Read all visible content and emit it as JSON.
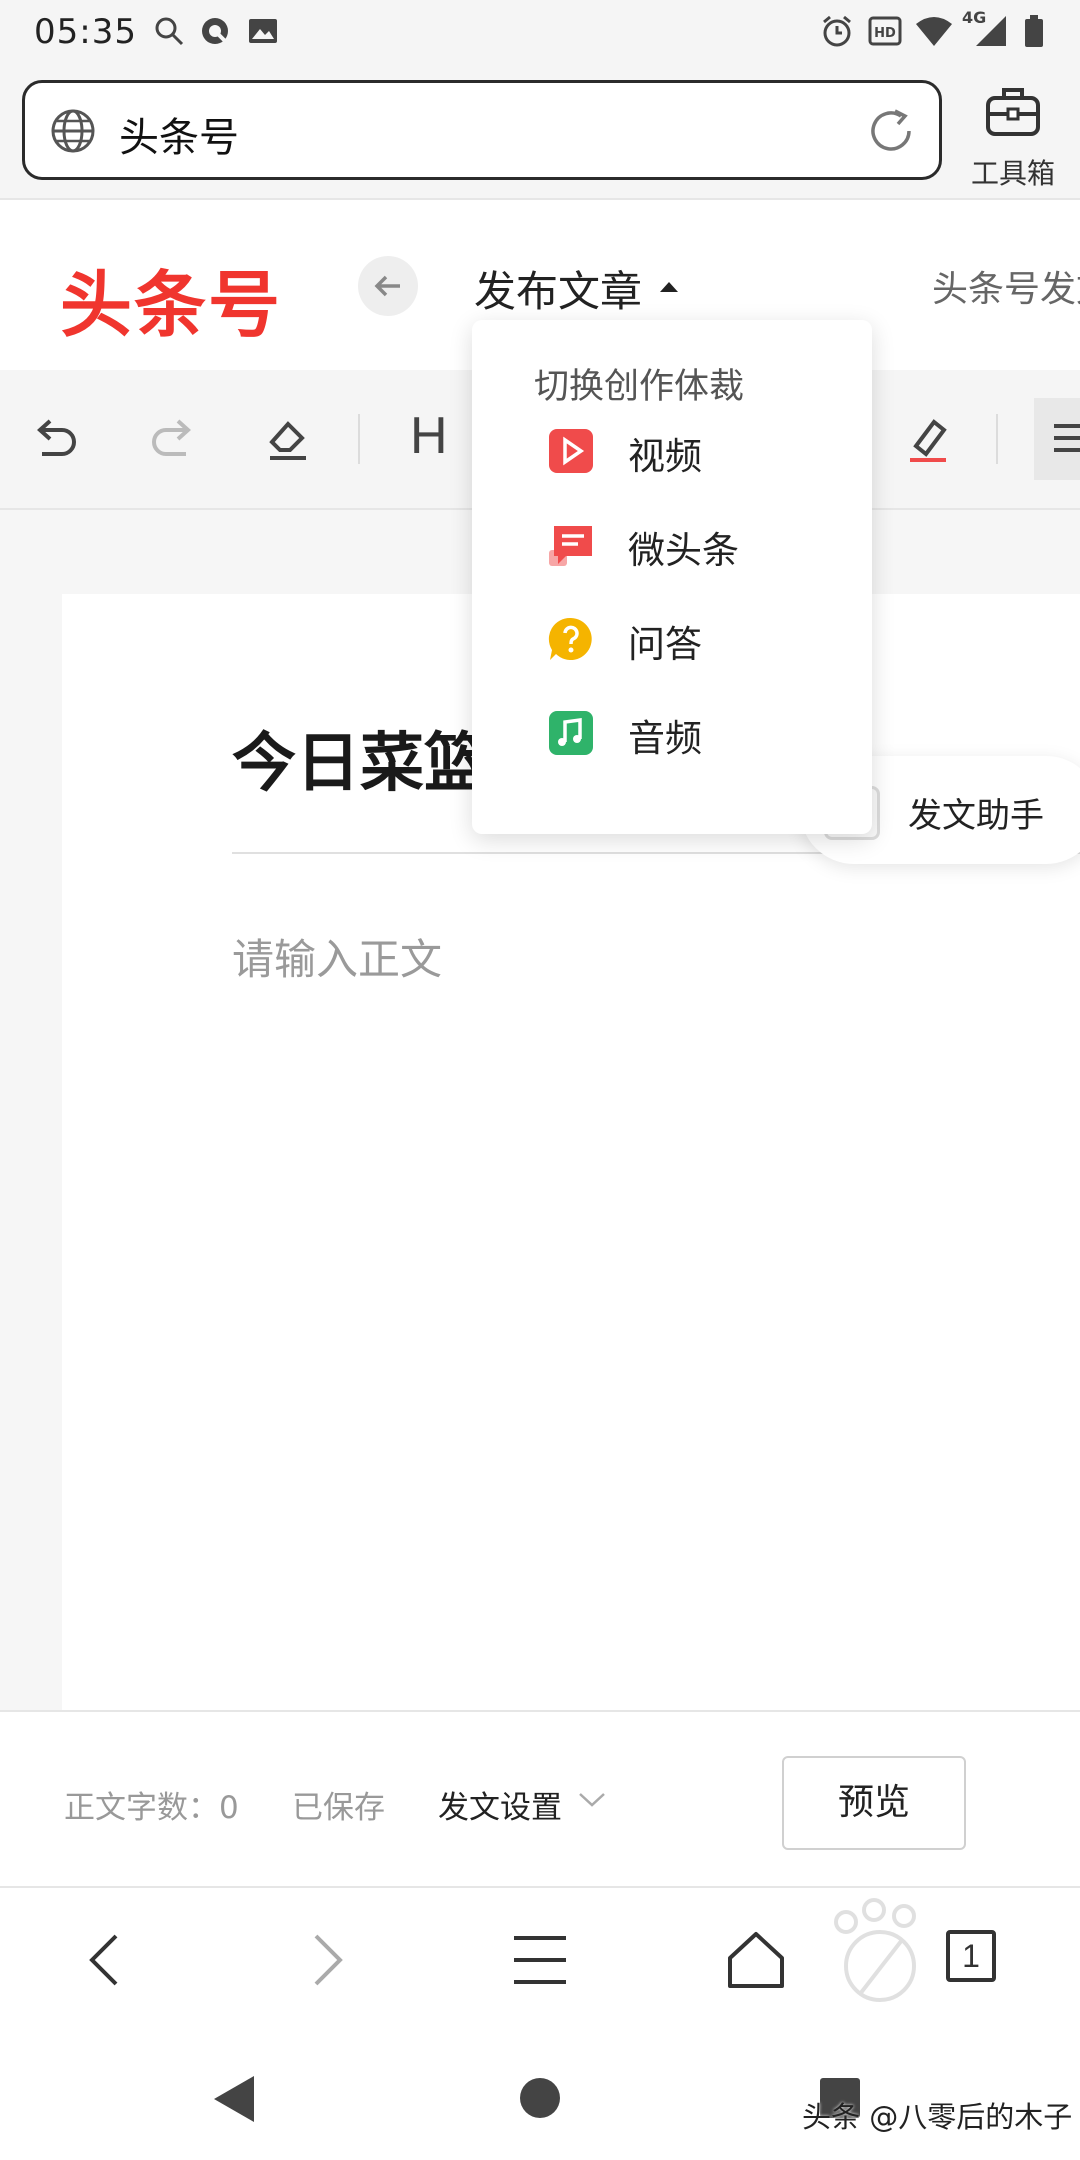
{
  "status_bar": {
    "time": "05:35",
    "network": "4G",
    "hd": "HD",
    "icons": [
      "search-icon",
      "browser-q-icon",
      "image-icon",
      "alarm-icon",
      "hd-icon",
      "wifi-icon",
      "signal-icon",
      "battery-icon"
    ]
  },
  "browser": {
    "url_text": "头条号",
    "toolbox_label": "工具箱",
    "icons": [
      "globe-icon",
      "reload-icon",
      "toolbox-icon"
    ]
  },
  "header": {
    "logo": "头条号",
    "publish_label": "发布文章",
    "right_text": "头条号发文"
  },
  "toolbar": {
    "heading_label": "H",
    "icons": [
      "undo-icon",
      "redo-icon",
      "eraser-icon",
      "heading-icon",
      "highlight-icon",
      "align-icon"
    ]
  },
  "dropdown": {
    "title": "切换创作体裁",
    "items": [
      {
        "label": "视频",
        "icon": "video-icon",
        "color": "#f04b4b"
      },
      {
        "label": "微头条",
        "icon": "micro-headline-icon",
        "color": "#f04b4b"
      },
      {
        "label": "问答",
        "icon": "question-icon",
        "color": "#f5b400"
      },
      {
        "label": "音频",
        "icon": "audio-icon",
        "color": "#2fb36a"
      }
    ]
  },
  "editor": {
    "title": "今日菜篮",
    "body_placeholder": "请输入正文",
    "helper_label": "发文助手"
  },
  "footer": {
    "word_count": "正文字数：0",
    "saved": "已保存",
    "settings": "发文设置",
    "preview": "预览"
  },
  "bottom_nav": {
    "tab_count": "1",
    "icons": [
      "back-icon",
      "forward-icon",
      "menu-icon",
      "home-icon",
      "tabs-icon"
    ]
  },
  "watermark": "头条 @八零后的木子",
  "colors": {
    "brand": "#f0352e",
    "text": "#222222",
    "muted": "#999999"
  }
}
